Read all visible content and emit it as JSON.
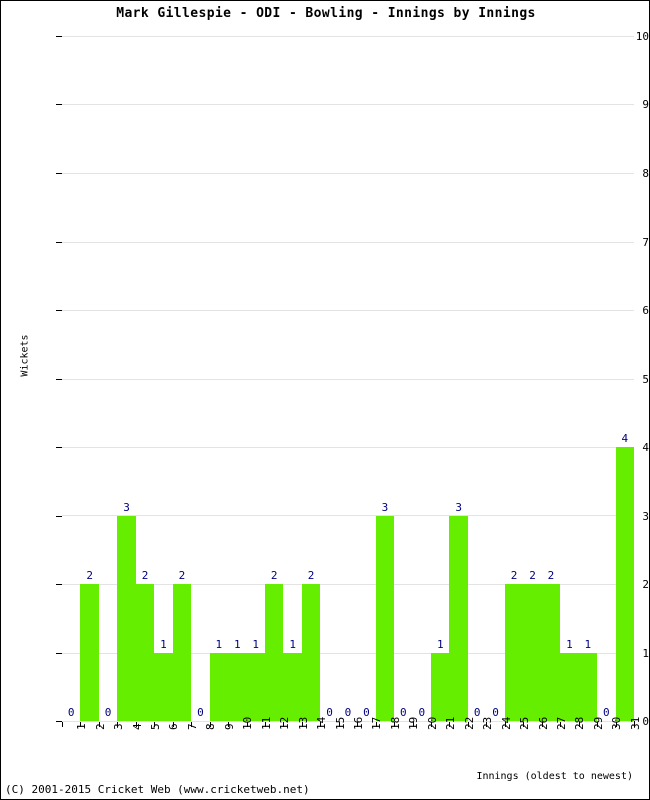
{
  "title": "Mark Gillespie - ODI - Bowling - Innings by Innings",
  "footer": "(C) 2001-2015 Cricket Web (www.cricketweb.net)",
  "colors": {
    "bar": "#66ee00",
    "label": "#000080",
    "grid": "#e3e3e3",
    "axis": "#000000",
    "background": "#ffffff"
  },
  "chart_data": {
    "type": "bar",
    "title": "Mark Gillespie - ODI - Bowling - Innings by Innings",
    "xlabel": "Innings (oldest to newest)",
    "ylabel": "Wickets",
    "ylim": [
      0,
      10
    ],
    "ytick_step": 1,
    "yticks": [
      "0",
      "1",
      "2",
      "3",
      "4",
      "5",
      "6",
      "7",
      "8",
      "9",
      "10"
    ],
    "grid": true,
    "legend": false,
    "bar_gap": 0,
    "categories": [
      "1",
      "2",
      "3",
      "4",
      "5",
      "6",
      "7",
      "8",
      "9",
      "10",
      "11",
      "12",
      "13",
      "14",
      "15",
      "16",
      "17",
      "18",
      "19",
      "20",
      "21",
      "22",
      "23",
      "24",
      "25",
      "26",
      "27",
      "28",
      "29",
      "30",
      "31"
    ],
    "values": [
      0,
      2,
      0,
      3,
      2,
      1,
      2,
      0,
      1,
      1,
      1,
      2,
      1,
      2,
      0,
      0,
      0,
      3,
      0,
      0,
      1,
      3,
      0,
      0,
      2,
      2,
      2,
      1,
      1,
      0,
      4
    ],
    "data_labels": [
      "0",
      "2",
      "0",
      "3",
      "2",
      "1",
      "2",
      "0",
      "1",
      "1",
      "1",
      "2",
      "1",
      "2",
      "0",
      "0",
      "0",
      "3",
      "0",
      "0",
      "1",
      "3",
      "0",
      "0",
      "2",
      "2",
      "2",
      "1",
      "1",
      "0",
      "4"
    ]
  }
}
